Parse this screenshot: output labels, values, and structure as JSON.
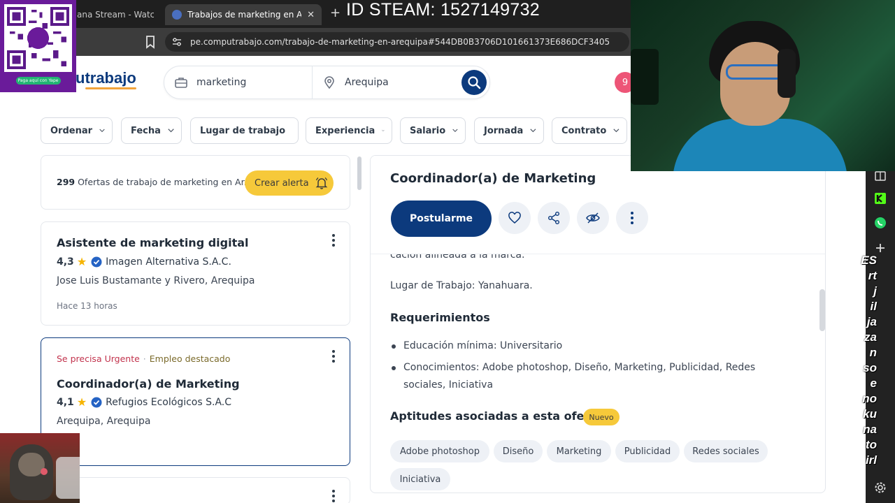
{
  "browser": {
    "tabs": [
      {
        "title": "ana Stream - Watch L"
      },
      {
        "title": "Trabajos de marketing en Arequi"
      }
    ],
    "url": "pe.computrabajo.com/trabajo-de-marketing-en-arequipa#544DB0B3706D101661373E686DCF3405"
  },
  "stream_overlay": {
    "steam_id": "ID STEAM: 1527149732",
    "qr_caption": "Paga aquí con Yape",
    "side_text": [
      "ES",
      "rt",
      "j",
      "il",
      "ja",
      "za",
      "n",
      "so",
      "e",
      "no",
      "ku",
      "na",
      "to",
      "irl"
    ]
  },
  "site": {
    "logo": "utrabajo",
    "search": {
      "keyword": "marketing",
      "location": "Arequipa"
    },
    "notifications": "9"
  },
  "filters": [
    "Ordenar",
    "Fecha",
    "Lugar de trabajo",
    "Experiencia",
    "Salario",
    "Jornada",
    "Contrato"
  ],
  "results": {
    "count": "299",
    "count_text": "Ofertas de trabajo de marketing en Ar...",
    "alert_button": "Crear alerta"
  },
  "jobs": [
    {
      "title": "Asistente de marketing digital",
      "rating": "4,3",
      "company": "Imagen Alternativa S.A.C.",
      "location": "Jose Luis Bustamante y Rivero, Arequipa",
      "posted": "Hace 13 horas"
    },
    {
      "urgent": "Se precisa Urgente",
      "featured": "Empleo destacado",
      "title": "Coordinador(a) de Marketing",
      "rating": "4,1",
      "company": "Refugios Ecológicos S.A.C",
      "location": "Arequipa, Arequipa"
    }
  ],
  "detail": {
    "title": "Coordinador(a) de Marketing",
    "apply_button": "Postularme",
    "cut_text": "cación alineada a la marca.",
    "workplace": "Lugar de Trabajo: Yanahuara.",
    "requirements_heading": "Requerimientos",
    "requirements": [
      "Educación mínima: Universitario",
      "Conocimientos: Adobe photoshop, Diseño, Marketing, Publicidad, Redes sociales, Iniciativa"
    ],
    "skills_heading": "Aptitudes asociadas a esta oferta",
    "new_badge": "Nuevo",
    "skills": [
      "Adobe photoshop",
      "Diseño",
      "Marketing",
      "Publicidad",
      "Redes sociales",
      "Iniciativa"
    ]
  },
  "colors": {
    "brand_blue": "#0c3a7d",
    "accent_yellow": "#f6c93a",
    "urgent_red": "#c2334d"
  }
}
